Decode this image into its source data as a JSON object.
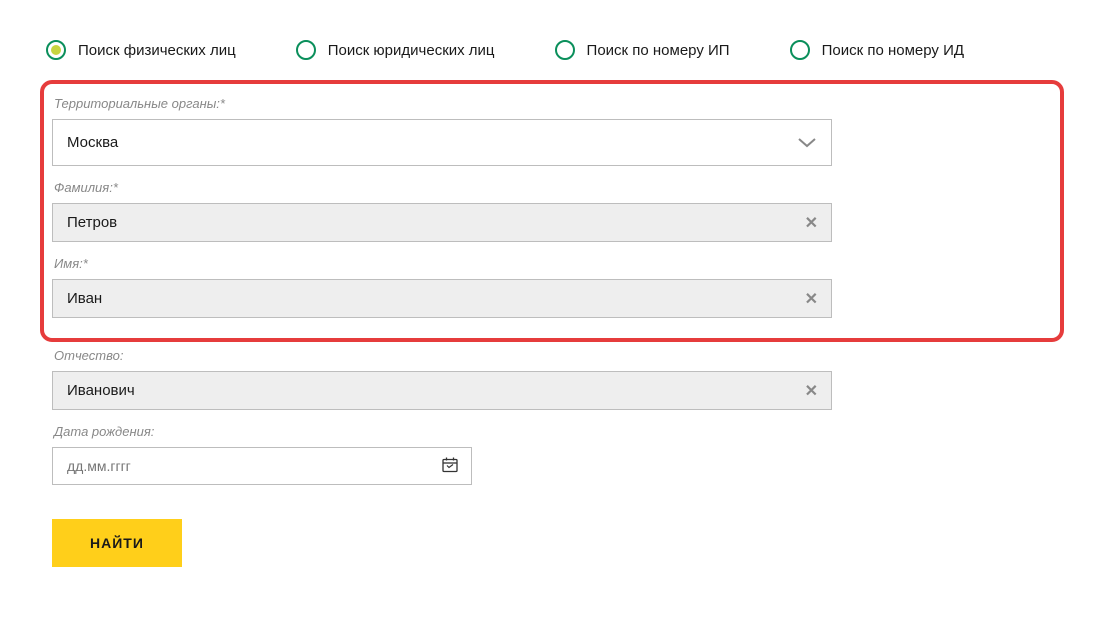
{
  "radios": {
    "physical": "Поиск физических лиц",
    "legal": "Поиск юридических лиц",
    "ip": "Поиск по номеру ИП",
    "id": "Поиск по номеру ИД"
  },
  "fields": {
    "territory": {
      "label": "Территориальные органы:*",
      "value": "Москва"
    },
    "lastname": {
      "label": "Фамилия:*",
      "value": "Петров"
    },
    "firstname": {
      "label": "Имя:*",
      "value": "Иван"
    },
    "patronymic": {
      "label": "Отчество:",
      "value": "Иванович"
    },
    "birthdate": {
      "label": "Дата рождения:",
      "placeholder": "дд.мм.гггг"
    }
  },
  "submit": "НАЙТИ"
}
